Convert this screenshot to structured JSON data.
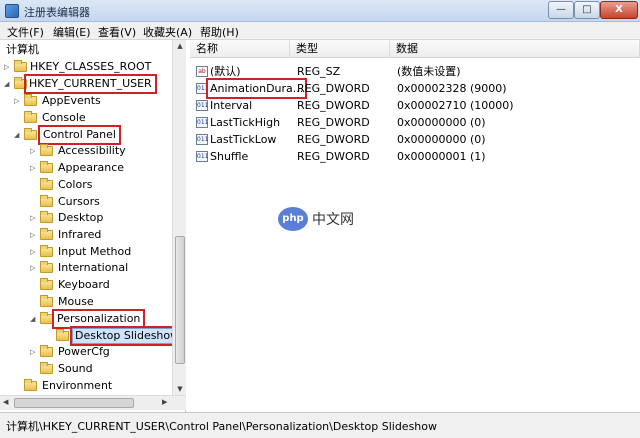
{
  "window": {
    "title": "注册表编辑器",
    "min": "—",
    "max": "□",
    "close": "X"
  },
  "menu": [
    "文件(F)",
    "编辑(E)",
    "查看(V)",
    "收藏夹(A)",
    "帮助(H)"
  ],
  "tree": {
    "root": "计算机",
    "items": [
      {
        "label": "HKEY_CLASSES_ROOT",
        "twisty": "▷"
      },
      {
        "label": "HKEY_CURRENT_USER",
        "twisty": "◢"
      },
      {
        "label": "AppEvents",
        "twisty": "▷"
      },
      {
        "label": "Console",
        "twisty": ""
      },
      {
        "label": "Control Panel",
        "twisty": "◢"
      },
      {
        "label": "Accessibility",
        "twisty": "▷"
      },
      {
        "label": "Appearance",
        "twisty": "▷"
      },
      {
        "label": "Colors",
        "twisty": ""
      },
      {
        "label": "Cursors",
        "twisty": ""
      },
      {
        "label": "Desktop",
        "twisty": "▷"
      },
      {
        "label": "Infrared",
        "twisty": "▷"
      },
      {
        "label": "Input Method",
        "twisty": "▷"
      },
      {
        "label": "International",
        "twisty": "▷"
      },
      {
        "label": "Keyboard",
        "twisty": ""
      },
      {
        "label": "Mouse",
        "twisty": ""
      },
      {
        "label": "Personalization",
        "twisty": "◢"
      },
      {
        "label": "Desktop Slideshow",
        "twisty": ""
      },
      {
        "label": "PowerCfg",
        "twisty": "▷"
      },
      {
        "label": "Sound",
        "twisty": ""
      },
      {
        "label": "Environment",
        "twisty": ""
      }
    ]
  },
  "columns": {
    "name": "名称",
    "type": "类型",
    "data": "数据"
  },
  "values": [
    {
      "icon": "ab",
      "name": "(默认)",
      "type": "REG_SZ",
      "data": "(数值未设置)"
    },
    {
      "icon": "011",
      "name": "AnimationDura...",
      "type": "REG_DWORD",
      "data": "0x00002328 (9000)"
    },
    {
      "icon": "011",
      "name": "Interval",
      "type": "REG_DWORD",
      "data": "0x00002710 (10000)"
    },
    {
      "icon": "011",
      "name": "LastTickHigh",
      "type": "REG_DWORD",
      "data": "0x00000000 (0)"
    },
    {
      "icon": "011",
      "name": "LastTickLow",
      "type": "REG_DWORD",
      "data": "0x00000000 (0)"
    },
    {
      "icon": "011",
      "name": "Shuffle",
      "type": "REG_DWORD",
      "data": "0x00000001 (1)"
    }
  ],
  "status": "计算机\\HKEY_CURRENT_USER\\Control Panel\\Personalization\\Desktop Slideshow",
  "watermark": {
    "badge": "php",
    "text": "中文网"
  },
  "scroll": {
    "up": "▲",
    "down": "▼",
    "left": "◀",
    "right": "▶"
  }
}
